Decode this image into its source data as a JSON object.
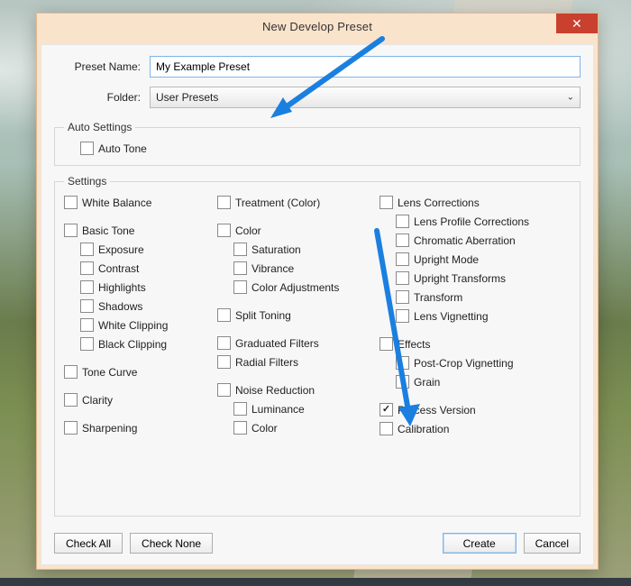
{
  "window": {
    "title": "New Develop Preset"
  },
  "form": {
    "preset_label": "Preset Name:",
    "preset_value": "My Example Preset",
    "folder_label": "Folder:",
    "folder_value": "User Presets"
  },
  "auto": {
    "legend": "Auto Settings",
    "auto_tone": "Auto Tone"
  },
  "settings": {
    "legend": "Settings",
    "col1": {
      "white_balance": "White Balance",
      "basic_tone": "Basic Tone",
      "exposure": "Exposure",
      "contrast": "Contrast",
      "highlights": "Highlights",
      "shadows": "Shadows",
      "white_clip": "White Clipping",
      "black_clip": "Black Clipping",
      "tone_curve": "Tone Curve",
      "clarity": "Clarity",
      "sharpening": "Sharpening"
    },
    "col2": {
      "treatment": "Treatment (Color)",
      "color": "Color",
      "saturation": "Saturation",
      "vibrance": "Vibrance",
      "color_adj": "Color Adjustments",
      "split_toning": "Split Toning",
      "grad_filters": "Graduated Filters",
      "radial_filters": "Radial Filters",
      "noise": "Noise Reduction",
      "luminance": "Luminance",
      "ncolor": "Color"
    },
    "col3": {
      "lens": "Lens Corrections",
      "lens_profile": "Lens Profile Corrections",
      "chromatic": "Chromatic Aberration",
      "upright_mode": "Upright Mode",
      "upright_trans": "Upright Transforms",
      "transform": "Transform",
      "lens_vig": "Lens Vignetting",
      "effects": "Effects",
      "postcrop": "Post-Crop Vignetting",
      "grain": "Grain",
      "process": "Process Version",
      "calibration": "Calibration"
    }
  },
  "buttons": {
    "check_all": "Check All",
    "check_none": "Check None",
    "create": "Create",
    "cancel": "Cancel"
  },
  "checked": {
    "process": true
  }
}
